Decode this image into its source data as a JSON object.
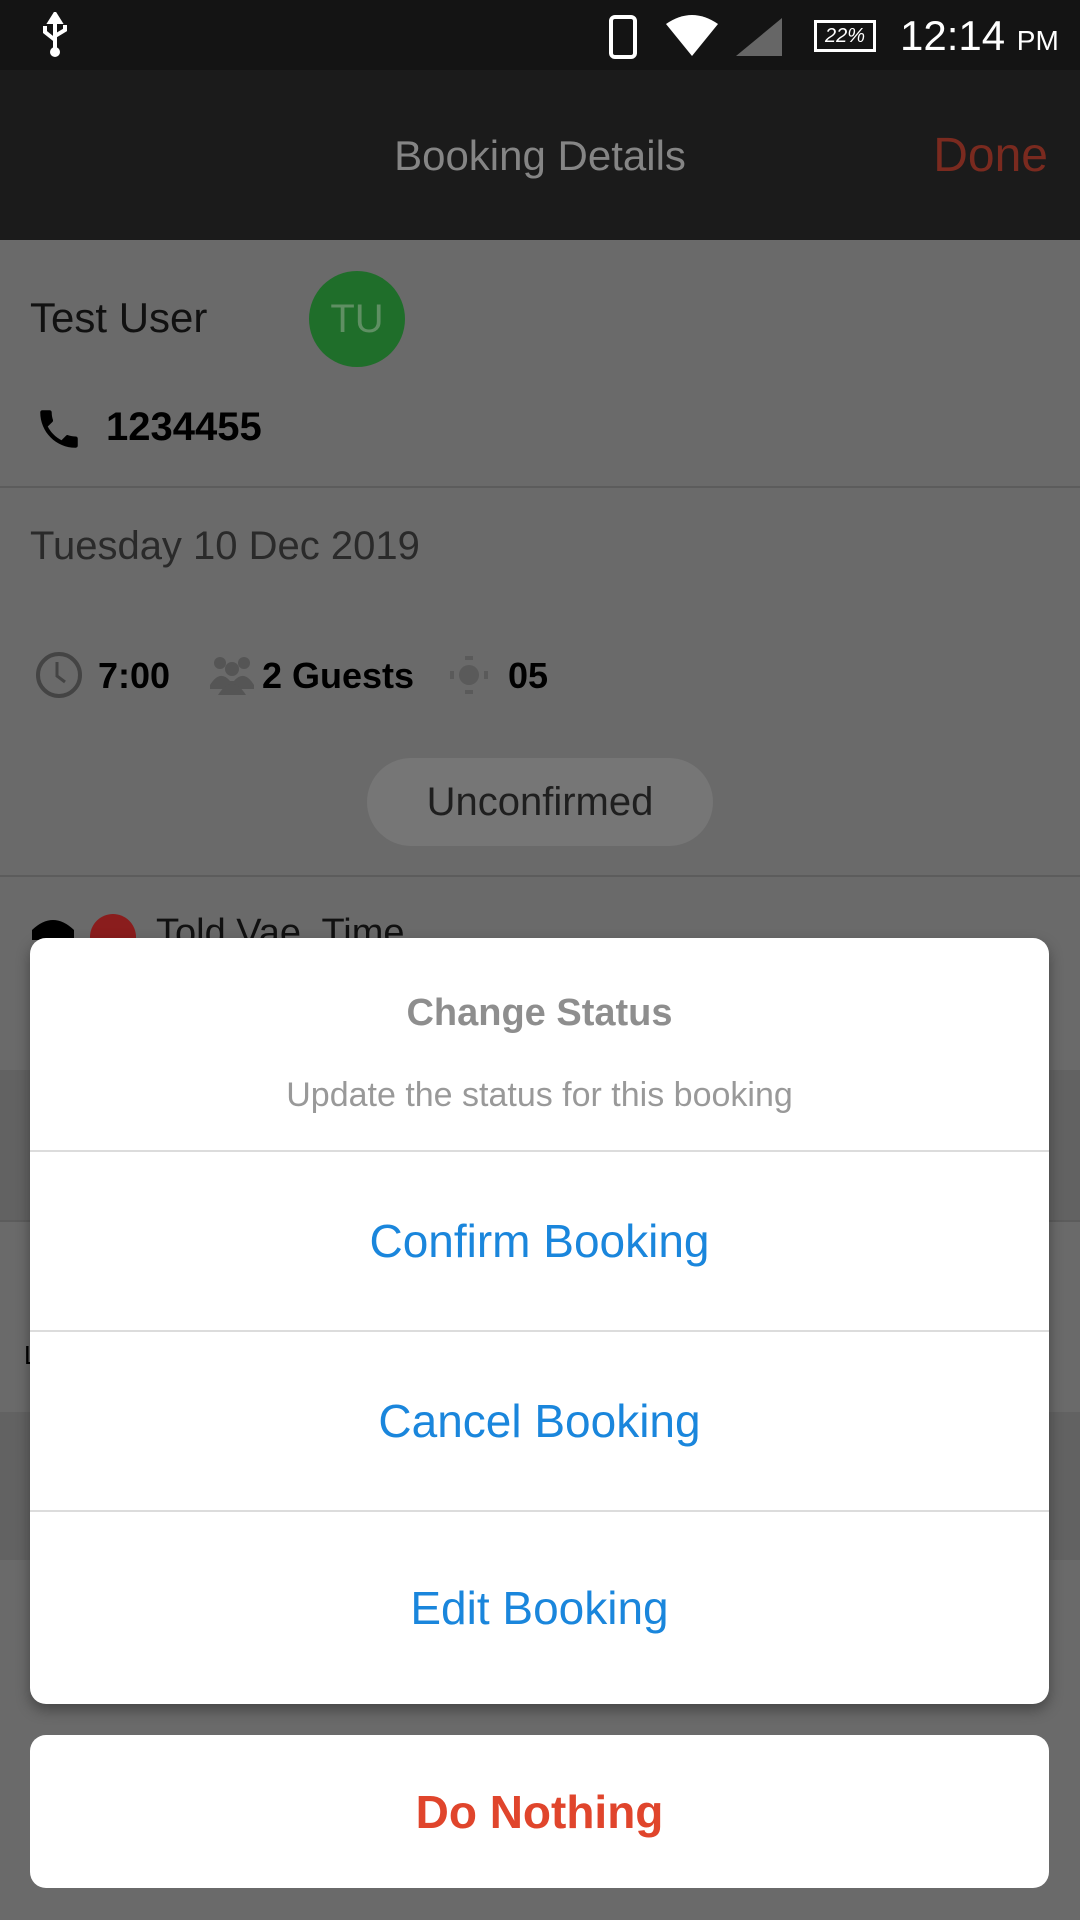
{
  "status_bar": {
    "time": "12:14",
    "ampm": "PM",
    "battery": "22%",
    "icons": [
      "usb-icon",
      "phone-icon",
      "wifi-icon",
      "signal-icon",
      "battery-icon"
    ]
  },
  "header": {
    "title": "Booking Details",
    "done_label": "Done"
  },
  "customer": {
    "name": "Test User",
    "initials": "TU",
    "phone": "1234455",
    "avatar_color": "#1f6e2a"
  },
  "booking": {
    "date": "Tuesday 10 Dec 2019",
    "time": "7:00",
    "guests": "2 Guests",
    "table": "05",
    "status": "Unconfirmed",
    "note": "Told Vae, Time",
    "partial_text": "L"
  },
  "dialog": {
    "title": "Change Status",
    "subtitle": "Update the status for this booking",
    "options": [
      "Confirm Booking",
      "Cancel Booking",
      "Edit Booking"
    ],
    "cancel_label": "Do Nothing"
  },
  "colors": {
    "accent": "#1a86dc",
    "destructive": "#e0452c"
  }
}
